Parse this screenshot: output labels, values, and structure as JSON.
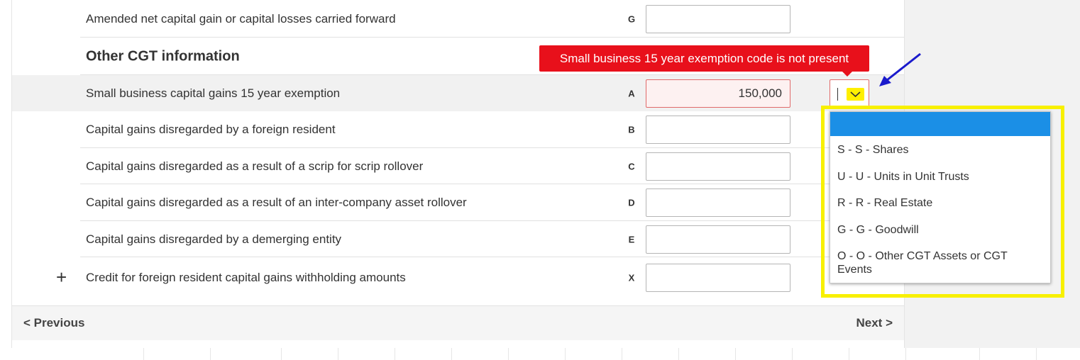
{
  "rows": [
    {
      "label": "Amended net capital gain or capital losses carried forward",
      "code": "G",
      "value": ""
    },
    {
      "label": "Small business capital gains 15 year exemption",
      "code": "A",
      "value": "150,000"
    },
    {
      "label": "Capital gains disregarded by a foreign resident",
      "code": "B",
      "value": ""
    },
    {
      "label": "Capital gains disregarded as a result of a scrip for scrip rollover",
      "code": "C",
      "value": ""
    },
    {
      "label": "Capital gains disregarded as a result of an inter-company asset rollover",
      "code": "D",
      "value": ""
    },
    {
      "label": "Capital gains disregarded by a demerging entity",
      "code": "E",
      "value": ""
    },
    {
      "label": "Credit for foreign resident capital gains withholding amounts",
      "code": "X",
      "value": ""
    }
  ],
  "section": {
    "title": "Other CGT information"
  },
  "expand_symbol": "+",
  "error_tooltip": "Small business 15 year exemption code is not present",
  "dropdown": {
    "selected": "",
    "options": [
      "S - S - Shares",
      "U - U - Units in Unit Trusts",
      "R - R - Real Estate",
      "G - G - Goodwill",
      "O - O - Other CGT Assets or CGT Events"
    ]
  },
  "footer": {
    "previous": "< Previous",
    "next": "Next >"
  },
  "colors": {
    "error": "#e8101b",
    "selected_option": "#1b8fe6",
    "highlight_box": "#f8f000",
    "annotation_arrow": "#1a1acc"
  }
}
